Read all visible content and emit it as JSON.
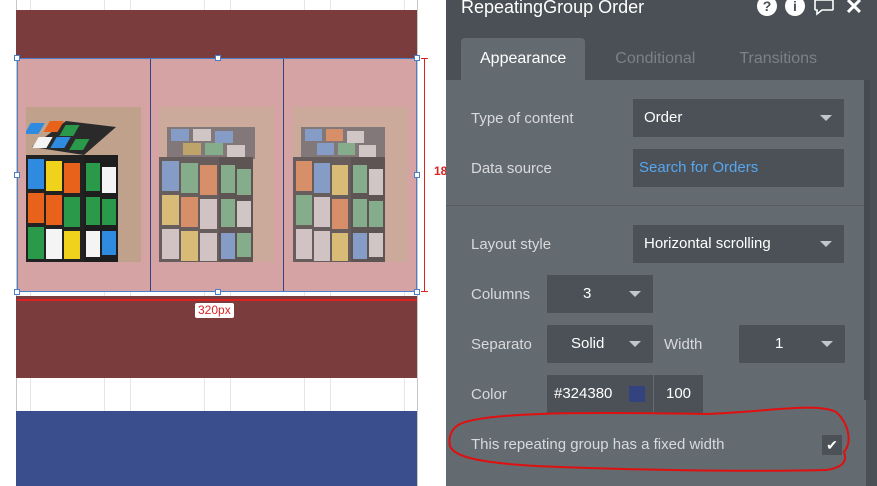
{
  "canvas": {
    "width_label": "320px",
    "height_label": "18",
    "rg_separator_color": "#324380",
    "band_color": "#7a3c3c",
    "rg_background": "#d6a3a4",
    "blue_band_color": "#3a4e8e"
  },
  "panel": {
    "title": "RepeatingGroup Order",
    "icons": [
      "help-icon",
      "info-icon",
      "comment-icon",
      "close-icon"
    ],
    "tabs": [
      {
        "label": "Appearance",
        "active": true
      },
      {
        "label": "Conditional",
        "active": false
      },
      {
        "label": "Transitions",
        "active": false
      }
    ],
    "type_of_content": {
      "label": "Type of content",
      "value": "Order"
    },
    "data_source": {
      "label": "Data source",
      "value": "Search for Orders"
    },
    "layout_style": {
      "label": "Layout style",
      "value": "Horizontal scrolling"
    },
    "columns": {
      "label": "Columns",
      "value": "3"
    },
    "separator": {
      "label": "Separato",
      "value": "Solid",
      "width_label": "Width",
      "width_value": "1"
    },
    "color": {
      "label": "Color",
      "value": "#324380",
      "opacity": "100",
      "swatch": "#324380"
    },
    "fixed_width": {
      "label": "This repeating group has a fixed width",
      "checked": true
    }
  }
}
